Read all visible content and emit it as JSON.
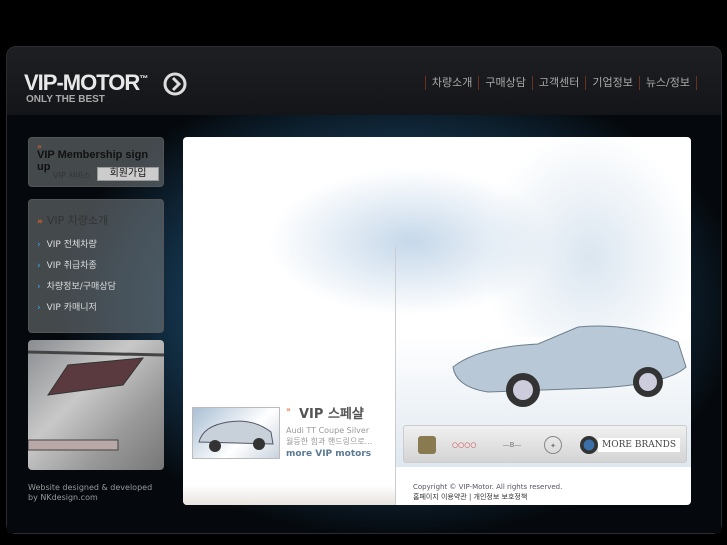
{
  "header": {
    "logo": "VIP-MOTOR",
    "logo_tm": "™",
    "tagline": "ONLY THE BEST",
    "nav": [
      "차량소개",
      "구매상담",
      "고객센터",
      "기업정보",
      "뉴스/정보"
    ]
  },
  "sidebar": {
    "membership": {
      "title": "VIP Membership sign up",
      "service_label": "VIP 서비스",
      "signup_button": "회원가입"
    },
    "menu": {
      "heading": "VIP 차량소개",
      "items": [
        "VIP 전체차량",
        "VIP 취급차종",
        "차량정보/구매상담",
        "VIP 카매니저"
      ]
    },
    "credit_line1": "Website designed & developed",
    "credit_line2": "by NKdesign.com"
  },
  "main": {
    "special": {
      "title": "VIP 스페샬",
      "car_name": "Audi TT Coupe Silver",
      "description": "월등한 힘과 핸드링으로...",
      "more_link": "more VIP motors"
    },
    "brands": [
      "Lamborghini",
      "Audi",
      "Bentley",
      "Mercedes",
      "BMW"
    ],
    "more_brands": "MORE BRANDS",
    "copyright": "Copyright © VIP-Motor. All rights reserved.",
    "footer_links": "홈페이지 이용약관 | 개인정보 보호정책"
  },
  "colors": {
    "accent": "#e2622a",
    "link": "#3aa8e8"
  }
}
